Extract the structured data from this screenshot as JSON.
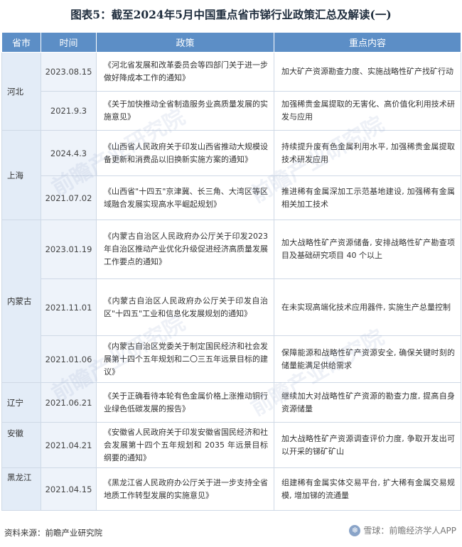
{
  "title": "图表5：截至2024年5月中国重点省市锑行业政策汇总及解读(一)",
  "headers": {
    "province": "省市",
    "date": "时间",
    "policy": "政策",
    "content": "重点内容"
  },
  "rows": [
    {
      "province": "河北",
      "date": "2023.08.15",
      "policy": "《河北省发展和改革委员会等四部门关于进一步做好降成本工作的通知》",
      "content": "加大矿产资源勘查力度、实施战略性矿产找矿行动"
    },
    {
      "province": "",
      "date": "2021.9.3",
      "policy": "《关于加快推动全省制造服务业高质量发展的实施意见》",
      "content": "加强稀贵金属提取的无害化、高价值化利用技术研发与应用"
    },
    {
      "province": "上海",
      "date": "2024.4.3",
      "policy": "《山西省人民政府关于印发山西省推动大规模设备更新和消费品以旧换新实施方案的通知》",
      "content": "持续提升废有色金属利用水平, 加强稀贵金属提取技术研发应用"
    },
    {
      "province": "",
      "date": "2021.07.02",
      "policy": "《山西省\"十四五\"京津冀、长三角、大湾区等区域融合发展实现高水平崛起规划》",
      "content": "推进稀有金属深加工示范基地建设, 加强稀有金属相关加工技术"
    },
    {
      "province": "内蒙古",
      "date": "2023.01.19",
      "policy": "《内蒙古自治区人民政府办公厅关于印发2023 年自治区推动产业优化升级促进经济高质量发展工作要点的通知》",
      "content": "加大战略性矿产资源储备, 安排战略性矿产勘查项目及基础研究项目 40 个以上"
    },
    {
      "province": "",
      "date": "2021.11.01",
      "policy": "《内蒙古自治区人民政府办公厅关于印发自治区\"十四五\"工业和信息化发展规划的通知》",
      "content": "在未实现高端化技术应用器件, 实施生产总量控制"
    },
    {
      "province": "",
      "date": "2021.01.06",
      "policy": "《内蒙古自治区党委关于制定国民经济和社会发展第十四个五年规划和二〇三五年远景目标的建议》",
      "content": "保障能源和战略性矿产资源安全, 确保关键时刻的储量能满足供给需求"
    },
    {
      "province": "辽宁",
      "date": "2021.06.21",
      "policy": "《关于正确看待本轮有色金属价格上涨推动铜行业绿色低碳发展的报告》",
      "content": "继续加大对战略性矿产资源的勘查力度, 提高自身资源储量"
    },
    {
      "province": "安徽",
      "date": "2021.04.21",
      "policy": "《安徽省人民政府关于印发安徽省国民经济和社会发展第十四个五年规划和 2035 年远景目标纲要的通知》",
      "content": "加大战略性矿产资源调查评价力度, 争取开发出可以开采的锑矿矿山"
    },
    {
      "province": "黑龙江",
      "date": "2021.04.15",
      "policy": "《黑龙江省人民政府办公厅关于进一步支持全省地质工作转型发展的实施意见》",
      "content": "组建稀有金属实体交易平台, 扩大稀有金属交易规模, 增加锑的流通量"
    }
  ],
  "footer": {
    "source": "资料来源：前瞻产业研究院",
    "logo_text": "雪球：前瞻经济学人APP"
  },
  "watermark_text": "前瞻产业研究院"
}
